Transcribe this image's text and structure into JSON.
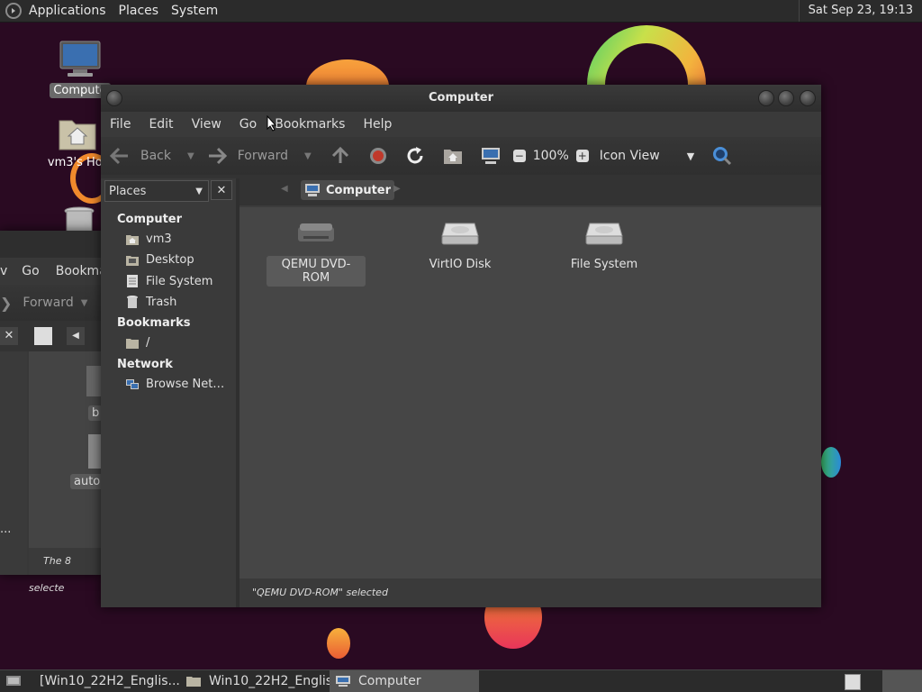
{
  "top_panel": {
    "menus": [
      "Applications",
      "Places",
      "System"
    ],
    "clock": "Sat Sep 23, 19:13"
  },
  "desktop": {
    "icons": [
      {
        "label": "Compute",
        "icon": "computer-icon"
      },
      {
        "label": "vm3's Hor",
        "icon": "home-folder-icon"
      },
      {
        "label": "",
        "icon": "trash-icon"
      }
    ]
  },
  "bg_window": {
    "menus": [
      "v",
      "Go",
      "Bookma"
    ],
    "forward_label": "Forward",
    "files": [
      "b",
      "auto"
    ],
    "side_trunc": "...",
    "status": "The 8 selecte"
  },
  "window": {
    "title": "Computer",
    "menus": [
      "File",
      "Edit",
      "View",
      "Go",
      "Bookmarks",
      "Help"
    ],
    "toolbar": {
      "back": "Back",
      "forward": "Forward",
      "zoom": "100%",
      "view_mode": "Icon View"
    },
    "pathbar": {
      "current": "Computer"
    },
    "sidebar": {
      "selector": "Places",
      "sections": [
        {
          "heading": "Computer",
          "items": [
            {
              "label": "vm3",
              "icon": "home-folder-icon"
            },
            {
              "label": "Desktop",
              "icon": "desktop-folder-icon"
            },
            {
              "label": "File System",
              "icon": "drive-icon"
            },
            {
              "label": "Trash",
              "icon": "trash-icon"
            }
          ]
        },
        {
          "heading": "Bookmarks",
          "items": [
            {
              "label": "/",
              "icon": "folder-icon"
            }
          ]
        },
        {
          "heading": "Network",
          "items": [
            {
              "label": "Browse Net…",
              "icon": "network-icon"
            }
          ]
        }
      ]
    },
    "devices": [
      {
        "label": "QEMU DVD-ROM",
        "icon": "optical-drive-icon",
        "selected": true
      },
      {
        "label": "VirtIO Disk",
        "icon": "hard-disk-icon",
        "selected": false
      },
      {
        "label": "File System",
        "icon": "hard-disk-icon",
        "selected": false
      }
    ],
    "status": "\"QEMU DVD-ROM\" selected"
  },
  "taskbar": {
    "tasks": [
      {
        "label": "[Win10_22H2_Englis...",
        "icon": "app-icon",
        "active": false
      },
      {
        "label": "Win10_22H2_Englis...",
        "icon": "folder-icon",
        "active": false
      },
      {
        "label": "Computer",
        "icon": "computer-icon",
        "active": true
      }
    ]
  },
  "colors": {
    "desktop_bg": "#2a0a22",
    "window_bg": "#3c3c3c",
    "content_bg": "#464646",
    "selection": "#5a5a5a",
    "stop_red": "#c0392b"
  }
}
